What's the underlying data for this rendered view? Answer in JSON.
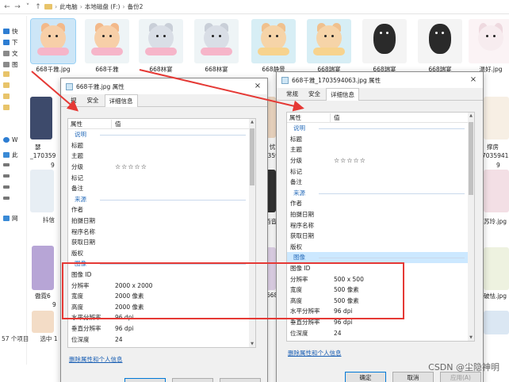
{
  "explorer": {
    "breadcrumb": [
      "此电脑",
      "本地磁盘 (F:)",
      "备份2"
    ],
    "sidebar": [
      "快",
      "下",
      "文",
      "图",
      "W",
      "此",
      "网"
    ],
    "top_tiles": [
      {
        "label": "668千雅.jpg"
      },
      {
        "label": "668千雅"
      },
      {
        "label": "668林宴"
      },
      {
        "label": "668林宴"
      },
      {
        "label": "668静景"
      },
      {
        "label": "668瑞宴"
      },
      {
        "label": "668瑞宴"
      },
      {
        "label": "温好.jpg"
      }
    ],
    "stripe_labels": {
      "l1": "瑟",
      "l2": "_170359",
      "l3": "9",
      "l4": "抖信",
      "l5": "傲霓6",
      "l6": "9",
      "m1": "忧",
      "m2": "70359",
      "m3": "陌音",
      "m4": "668",
      "r1": "撑房",
      "r2": "70359412",
      "r3": "9",
      "r4": "苏玲.jpg",
      "r5": "破怯.jpg"
    },
    "status_count": "57 个项目",
    "status_selected": "选中 1"
  },
  "dialog1": {
    "title": "668千雅.jpg 属性",
    "close": "×",
    "tabs": [
      "规",
      "安全",
      "详细信息"
    ],
    "header": {
      "name": "属性",
      "value": "值"
    },
    "rows": [
      {
        "type": "group",
        "k": "说明"
      },
      {
        "k": "标题",
        "v": ""
      },
      {
        "k": "主题",
        "v": ""
      },
      {
        "k": "分级",
        "v": "☆☆☆☆☆",
        "stars": true
      },
      {
        "k": "标记",
        "v": ""
      },
      {
        "k": "备注",
        "v": ""
      },
      {
        "type": "group",
        "k": "来源"
      },
      {
        "k": "作者",
        "v": ""
      },
      {
        "k": "拍摄日期",
        "v": ""
      },
      {
        "k": "程序名称",
        "v": ""
      },
      {
        "k": "获取日期",
        "v": ""
      },
      {
        "k": "版权",
        "v": ""
      },
      {
        "type": "group",
        "k": "图像"
      },
      {
        "k": "图像 ID",
        "v": ""
      },
      {
        "k": "分辨率",
        "v": "2000 x 2000"
      },
      {
        "k": "宽度",
        "v": "2000 像素"
      },
      {
        "k": "高度",
        "v": "2000 像素"
      },
      {
        "k": "水平分辨率",
        "v": "96 dpi"
      },
      {
        "k": "垂直分辨率",
        "v": "96 dpi"
      },
      {
        "k": "位深度",
        "v": "24"
      }
    ],
    "remove_link": "删除属性和个人信息"
  },
  "dialog2": {
    "title": "668千雅_1703594063.jpg 属性",
    "close": "×",
    "tabs": [
      "常规",
      "安全",
      "详细信息"
    ],
    "header": {
      "name": "属性",
      "value": "值"
    },
    "rows": [
      {
        "type": "group",
        "k": "说明"
      },
      {
        "k": "标题",
        "v": ""
      },
      {
        "k": "主题",
        "v": ""
      },
      {
        "k": "分级",
        "v": "☆☆☆☆☆",
        "stars": true
      },
      {
        "k": "标记",
        "v": ""
      },
      {
        "k": "备注",
        "v": ""
      },
      {
        "type": "group",
        "k": "来源"
      },
      {
        "k": "作者",
        "v": ""
      },
      {
        "k": "拍摄日期",
        "v": ""
      },
      {
        "k": "程序名称",
        "v": ""
      },
      {
        "k": "获取日期",
        "v": ""
      },
      {
        "k": "版权",
        "v": ""
      },
      {
        "type": "group",
        "k": "图像",
        "sel": true
      },
      {
        "k": "图像 ID",
        "v": ""
      },
      {
        "k": "分辨率",
        "v": "500 x 500"
      },
      {
        "k": "宽度",
        "v": "500 像素"
      },
      {
        "k": "高度",
        "v": "500 像素"
      },
      {
        "k": "水平分辨率",
        "v": "96 dpi"
      },
      {
        "k": "垂直分辨率",
        "v": "96 dpi"
      },
      {
        "k": "位深度",
        "v": "24"
      }
    ],
    "remove_link": "删除属性和个人信息",
    "ok": "确定",
    "cancel": "取消",
    "apply": "应用(A)"
  },
  "watermark": "CSDN @尘隐神明",
  "colors": {
    "highlight": "#e53935",
    "link": "#1a5fb4",
    "group": "#2a6ebb"
  }
}
